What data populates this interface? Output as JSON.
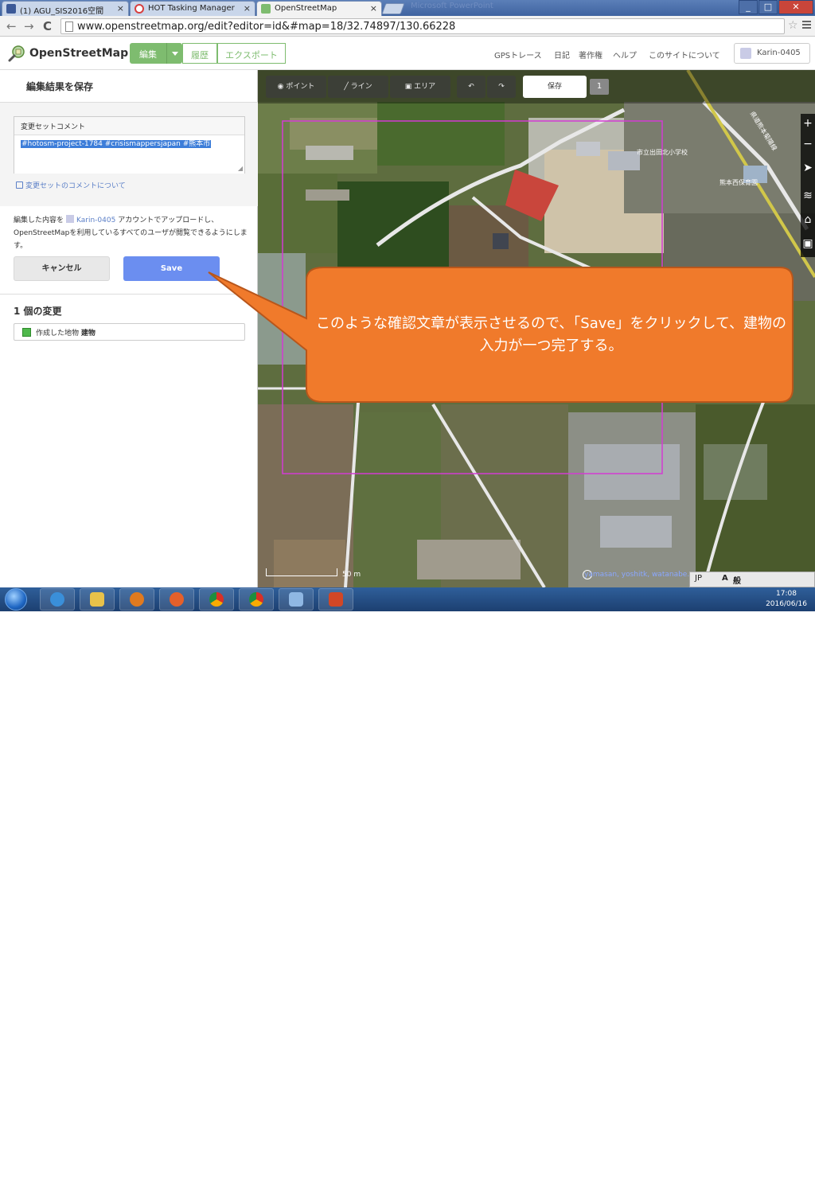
{
  "browser": {
    "tabs": [
      {
        "title": "(1) AGU_SIS2016空間",
        "close": "×",
        "favicon_color": "#3b5998"
      },
      {
        "title": "HOT Tasking Manager",
        "close": "×",
        "favicon_color": "#d73f3f"
      },
      {
        "title": "OpenStreetMap",
        "close": "×",
        "favicon_color": "#7ebc6f"
      }
    ],
    "ghost_tab": "Microsoft PowerPoint",
    "window_buttons": [
      "_",
      "□",
      "✕"
    ],
    "url": "www.openstreetmap.org/edit?editor=id&#map=18/32.74897/130.66228",
    "nav": {
      "back": "←",
      "forward": "→",
      "reload": "C"
    },
    "star": "☆"
  },
  "header": {
    "site_name": "OpenStreetMap",
    "edit_label": "編集",
    "history_label": "履歴",
    "export_label": "エクスポート",
    "links": [
      "GPSトレース",
      "日記",
      "著作権",
      "ヘルプ",
      "このサイトについて"
    ],
    "user": "Karin-0405"
  },
  "sidebar": {
    "title": "編集結果を保存",
    "changeset_label": "変更セットコメント",
    "changeset_comment": "#hotosm-project-1784 #crisismappersjapan #熊本市",
    "about_link": "変更セットのコメントについて",
    "upload_prefix": "編集した内容を",
    "upload_user": "Karin-0405",
    "upload_suffix": "アカウントでアップロードし、OpenStreetMapを利用しているすべてのユーザが閲覧できるようにします。",
    "cancel_label": "キャンセル",
    "save_label": "Save",
    "changes_title": "1 個の変更",
    "change_item_prefix": "作成した地物",
    "change_item_type": "建物"
  },
  "map": {
    "toolbar": {
      "point": "ポイント",
      "line": "ライン",
      "area": "エリア",
      "undo": "↶",
      "redo": "↷",
      "save": "保存",
      "save_count": "1"
    },
    "controls": [
      "+",
      "−",
      "➤",
      "≋",
      "⌂",
      "▣"
    ],
    "labels": {
      "school": "市立出田北小学校",
      "kindergarten": "熊本西保育園",
      "road": "県道熊本菊陽線"
    },
    "scale": "50 m",
    "attribution": "yamasan, yoshitk, watanabe..."
  },
  "callout": {
    "text": "このような確認文章が表示させるので、「Save」をクリックして、建物の入力が一つ完了する。",
    "color": "#f07a2b"
  },
  "taskbar": {
    "time": "17:08",
    "date": "2016/06/16",
    "ime": [
      "JP",
      "A",
      "般"
    ],
    "tray": "▲ ⚐ ◀)"
  }
}
